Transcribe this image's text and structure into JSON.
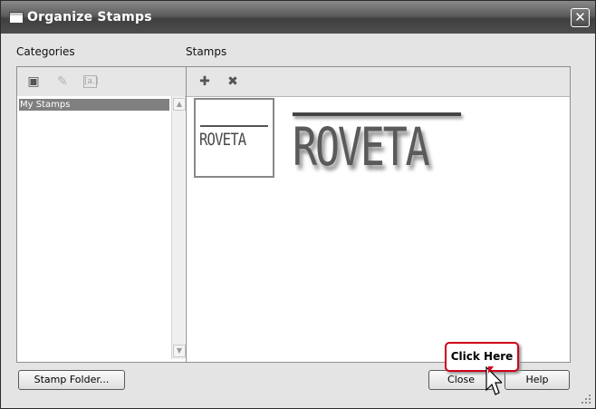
{
  "window": {
    "title": "Organize Stamps",
    "close_glyph": "✕"
  },
  "categories": {
    "label": "Categories",
    "toolbar": [
      {
        "name": "add-category-icon",
        "glyph": "▣",
        "enabled": true
      },
      {
        "name": "delete-category-icon",
        "glyph": "✎",
        "enabled": false
      },
      {
        "name": "rename-category-icon",
        "glyph": "[a.]",
        "enabled": false
      }
    ],
    "items": [
      {
        "label": "My Stamps",
        "selected": true
      }
    ]
  },
  "stamps": {
    "label": "Stamps",
    "toolbar": [
      {
        "name": "add-stamp-icon",
        "glyph": "✚"
      },
      {
        "name": "delete-stamp-icon",
        "glyph": "✖"
      }
    ],
    "items": [
      {
        "text": "ROVETA",
        "selected": true
      }
    ],
    "preview_text": "ROVETA"
  },
  "buttons": {
    "stamp_folder": "Stamp Folder...",
    "close": "Close",
    "help": "Help"
  },
  "callout": {
    "text": "Click Here",
    "border_color": "#d0021b"
  }
}
